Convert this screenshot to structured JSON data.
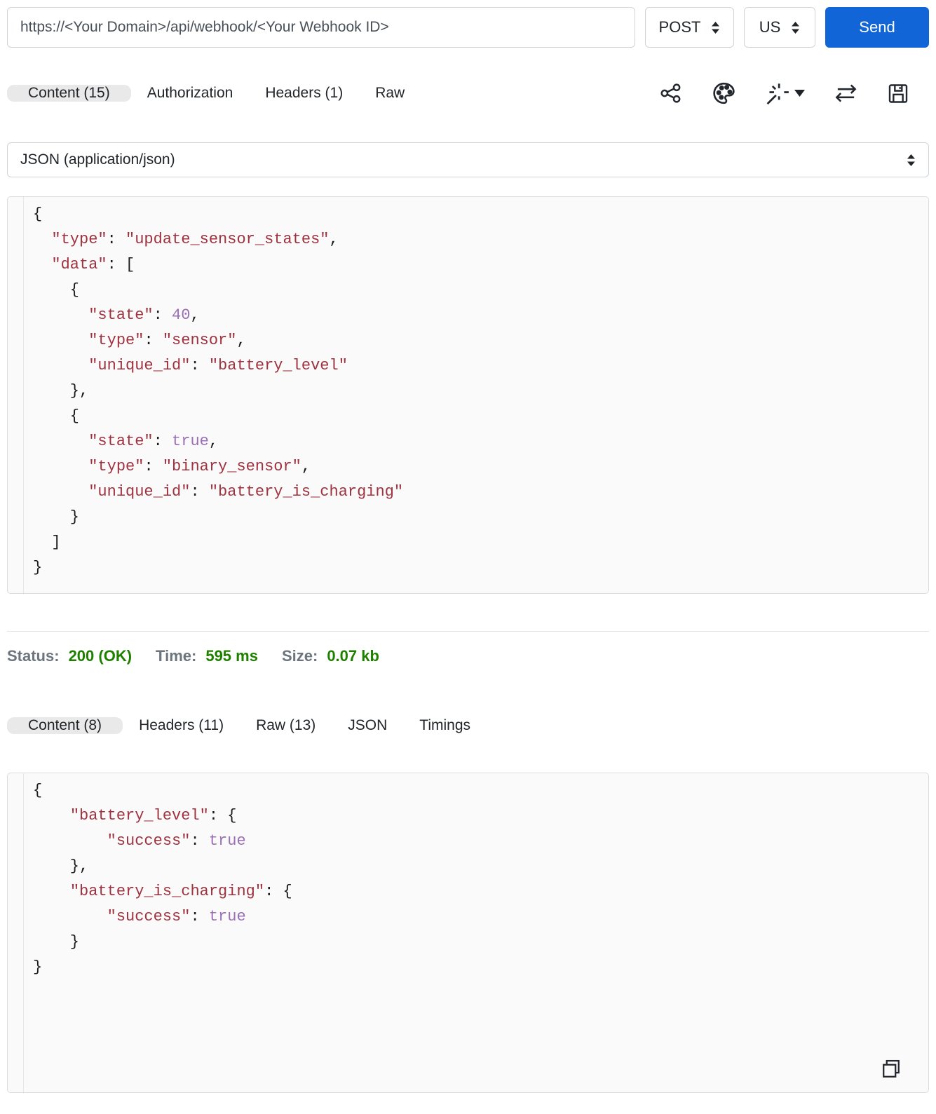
{
  "colors": {
    "accent": "#1165d6",
    "success": "#1f8000",
    "muted": "#6c757d",
    "code-str": "#a0313f",
    "code-lit": "#9a6fb5"
  },
  "request_bar": {
    "url": "https://<Your Domain>/api/webhook/<Your Webhook ID>",
    "method": "POST",
    "region": "US",
    "send_label": "Send"
  },
  "request_panel": {
    "tabs": [
      "Content (15)",
      "Authorization",
      "Headers (1)",
      "Raw"
    ],
    "toolbar_icons": [
      "share",
      "palette",
      "magic-wand-menu",
      "swap-arrows",
      "save"
    ],
    "body_type": "JSON (application/json)",
    "code_lines": [
      "{",
      "  \"type\": \"update_sensor_states\",",
      "  \"data\": [",
      "    {",
      "      \"state\": 40,",
      "      \"type\": \"sensor\",",
      "      \"unique_id\": \"battery_level\"",
      "    },",
      "    {",
      "      \"state\": true,",
      "      \"type\": \"binary_sensor\",",
      "      \"unique_id\": \"battery_is_charging\"",
      "    }",
      "  ]",
      "}"
    ]
  },
  "response_summary": {
    "status_label": "Status:",
    "status_value": "200 (OK)",
    "time_label": "Time:",
    "time_value": "595 ms",
    "size_label": "Size:",
    "size_value": "0.07 kb"
  },
  "response_panel": {
    "tabs": [
      "Content (8)",
      "Headers (11)",
      "Raw (13)",
      "JSON",
      "Timings"
    ],
    "code_lines": [
      "{",
      "    \"battery_level\": {",
      "        \"success\": true",
      "    },",
      "    \"battery_is_charging\": {",
      "        \"success\": true",
      "    }",
      "}"
    ]
  }
}
